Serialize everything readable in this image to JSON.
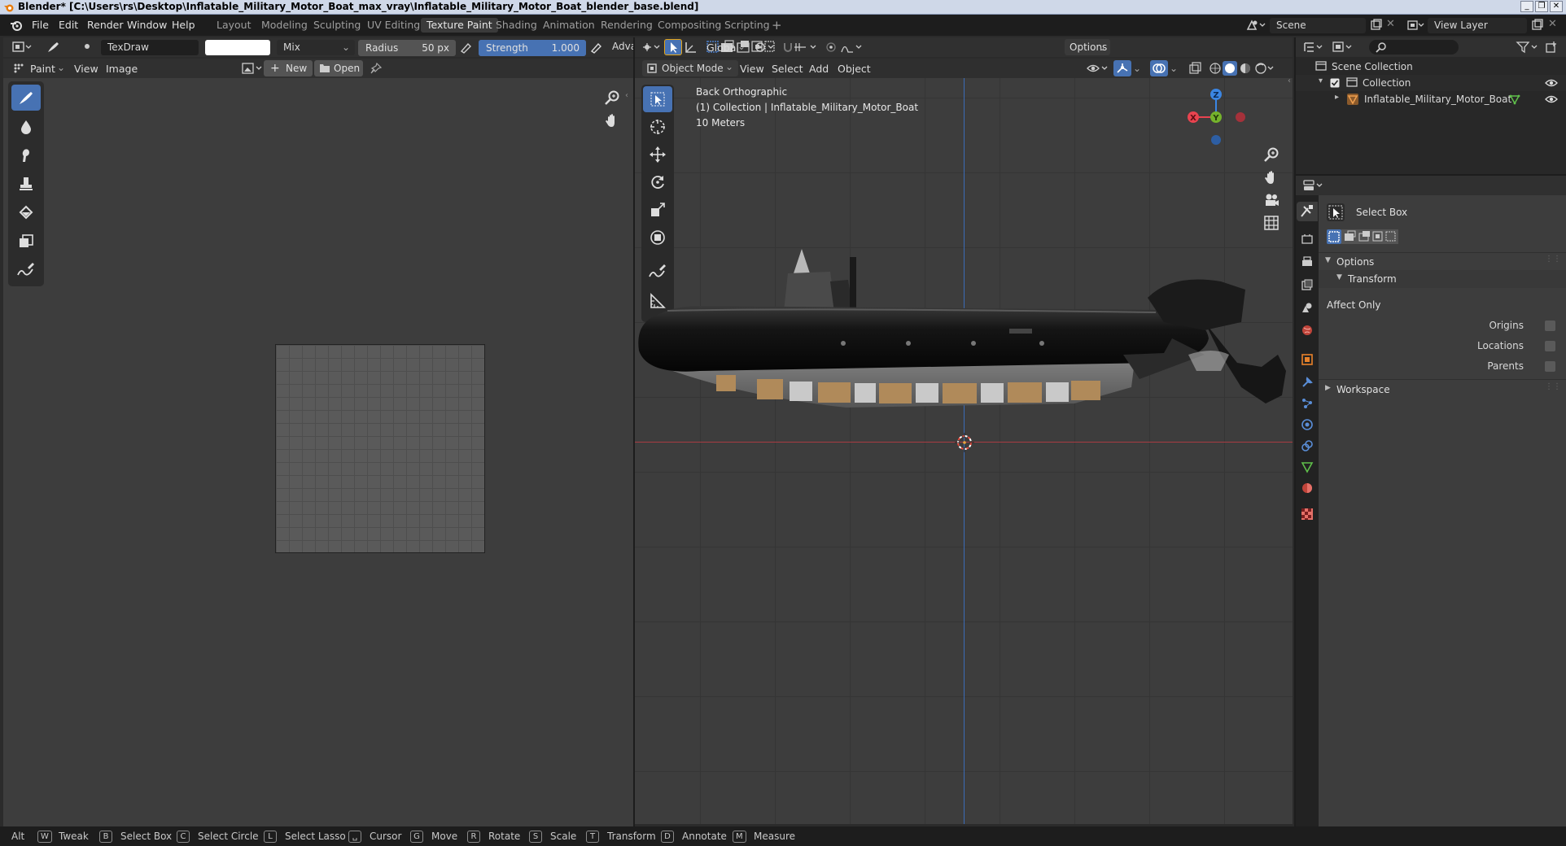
{
  "window": {
    "title": "Blender* [C:\\Users\\rs\\Desktop\\Inflatable_Military_Motor_Boat_max_vray\\Inflatable_Military_Motor_Boat_blender_base.blend]"
  },
  "menu": [
    "File",
    "Edit",
    "Render",
    "Window",
    "Help"
  ],
  "workspaces": [
    {
      "label": "Layout",
      "active": false
    },
    {
      "label": "Modeling",
      "active": false
    },
    {
      "label": "Sculpting",
      "active": false
    },
    {
      "label": "UV Editing",
      "active": false
    },
    {
      "label": "Texture Paint",
      "active": true
    },
    {
      "label": "Shading",
      "active": false
    },
    {
      "label": "Animation",
      "active": false
    },
    {
      "label": "Rendering",
      "active": false
    },
    {
      "label": "Compositing",
      "active": false
    },
    {
      "label": "Scripting",
      "active": false
    }
  ],
  "scene": {
    "label": "Scene",
    "view_layer": "View Layer"
  },
  "paint_header": {
    "brush_name": "TexDraw",
    "blend_mode": "Mix",
    "radius_label": "Radius",
    "radius_value": "50 px",
    "strength_label": "Strength",
    "strength_value": "1.000",
    "strength_fraction": 1.0,
    "advanced_label": "Adva"
  },
  "image_editor": {
    "mode": "Paint",
    "menus": [
      "View",
      "Image"
    ],
    "new_label": "New",
    "open_label": "Open"
  },
  "viewport": {
    "mode": "Object Mode",
    "menus": [
      "View",
      "Select",
      "Add",
      "Object"
    ],
    "orientation": "Global",
    "options_label": "Options",
    "info_view": "Back Orthographic",
    "info_collection": "(1) Collection | Inflatable_Military_Motor_Boat",
    "info_scale": "10 Meters",
    "gizmo": {
      "z": "Z",
      "x": "X",
      "y": "Y"
    }
  },
  "outliner": {
    "scene_collection": "Scene Collection",
    "collection": "Collection",
    "object": "Inflatable_Military_Motor_Boat"
  },
  "properties": {
    "tool_name": "Select Box",
    "options": "Options",
    "transform": "Transform",
    "affect_only": "Affect Only",
    "origins": "Origins",
    "locations": "Locations",
    "parents": "Parents",
    "workspace": "Workspace"
  },
  "statusbar": [
    {
      "key": "Alt",
      "label": ""
    },
    {
      "key": "W",
      "label": "Tweak"
    },
    {
      "key": "B",
      "label": "Select Box"
    },
    {
      "key": "C",
      "label": "Select Circle"
    },
    {
      "key": "L",
      "label": "Select Lasso"
    },
    {
      "key": "␣",
      "label": "Cursor"
    },
    {
      "key": "G",
      "label": "Move"
    },
    {
      "key": "R",
      "label": "Rotate"
    },
    {
      "key": "S",
      "label": "Scale"
    },
    {
      "key": "T",
      "label": "Transform"
    },
    {
      "key": "D",
      "label": "Annotate"
    },
    {
      "key": "M",
      "label": "Measure"
    }
  ],
  "colors": {
    "accent": "#4772b3",
    "x_axis": "#e8434f",
    "y_axis": "#75b32c",
    "z_axis": "#3b86e3"
  }
}
